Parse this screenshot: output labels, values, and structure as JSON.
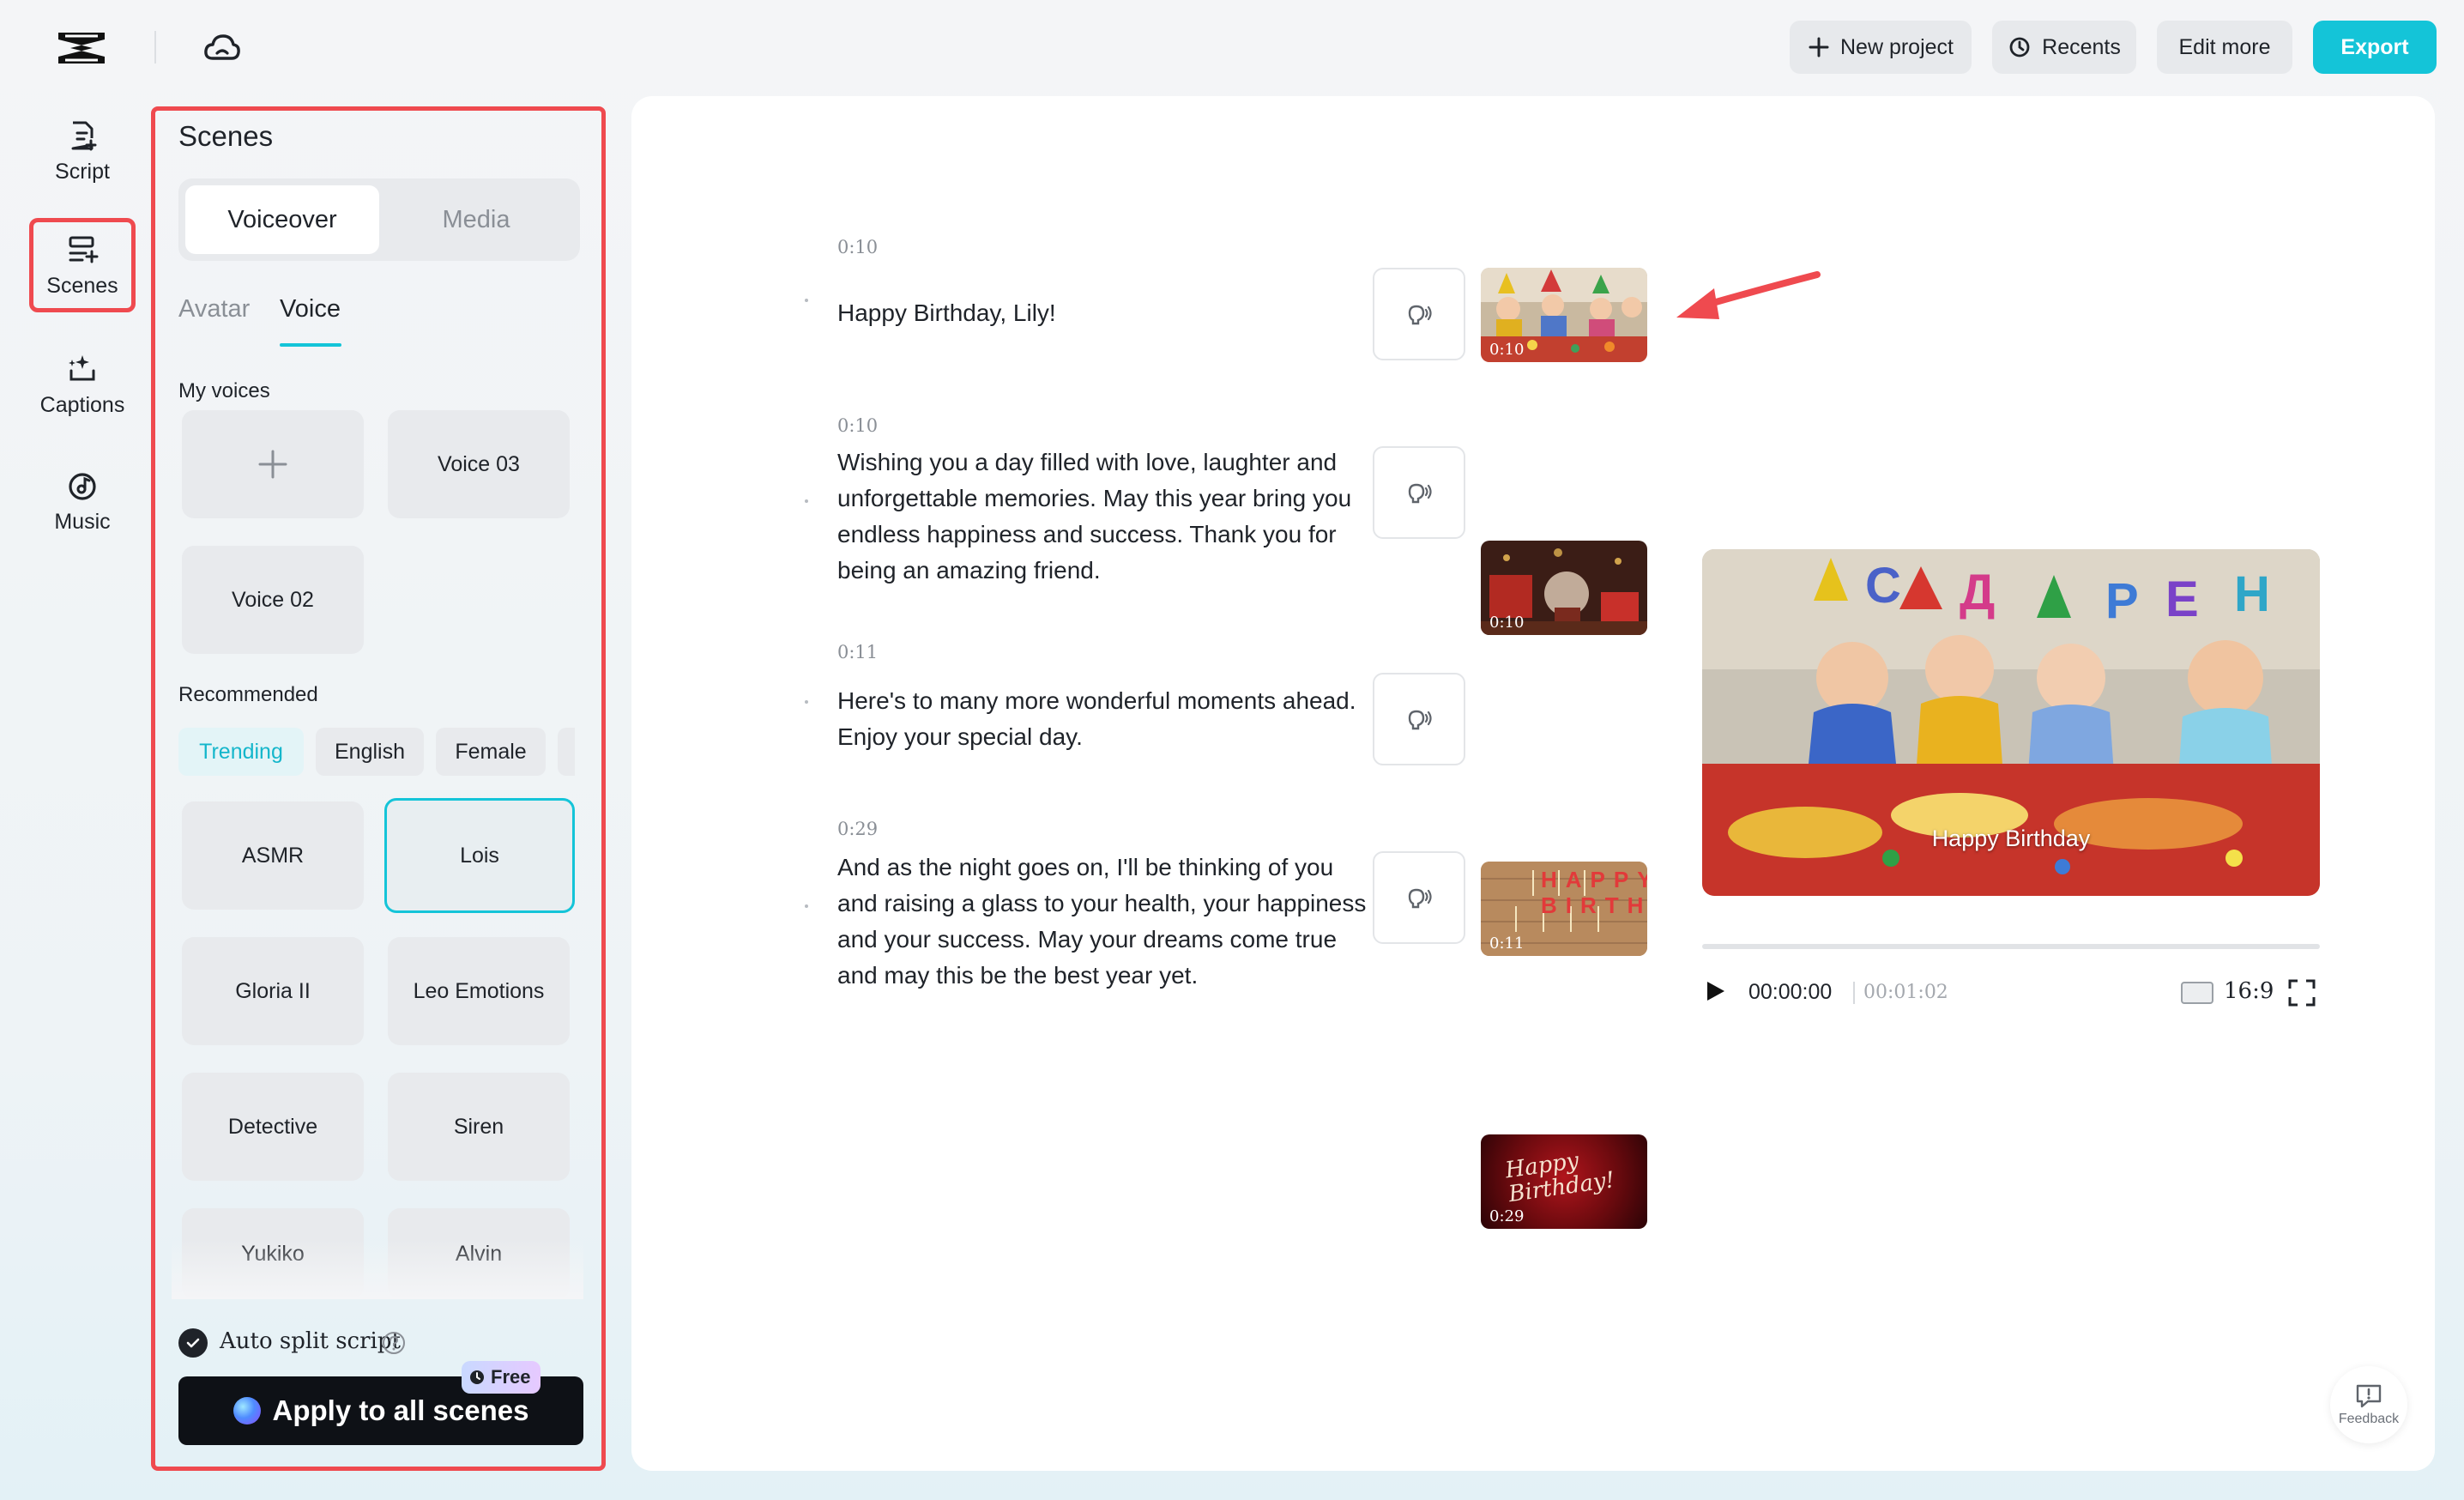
{
  "topbar": {
    "new_project": "New project",
    "recents": "Recents",
    "edit_more": "Edit more",
    "export": "Export"
  },
  "rail": {
    "items": [
      {
        "label": "Script",
        "icon": "script-icon"
      },
      {
        "label": "Scenes",
        "icon": "scenes-icon"
      },
      {
        "label": "Captions",
        "icon": "captions-icon"
      },
      {
        "label": "Music",
        "icon": "music-icon"
      }
    ]
  },
  "panel": {
    "title": "Scenes",
    "segments": [
      "Voiceover",
      "Media"
    ],
    "subtabs": [
      "Avatar",
      "Voice"
    ],
    "my_voices_label": "My voices",
    "my_voices": [
      "+",
      "Voice 03",
      "Voice 02"
    ],
    "recommended_label": "Recommended",
    "chips": [
      "Trending",
      "English",
      "Female"
    ],
    "voices": [
      "ASMR",
      "Lois",
      "Gloria II",
      "Leo Emotions",
      "Detective",
      "Siren",
      "Yukiko",
      "Alvin"
    ],
    "selected_voice": "Lois",
    "auto_split": "Auto split script",
    "apply_button": "Apply to all scenes",
    "free_badge": "Free"
  },
  "scenes": [
    {
      "time": "0:10",
      "text": "Happy Birthday, Lily!",
      "thumb_time": "0:10"
    },
    {
      "time": "0:10",
      "text": "Wishing you a day filled with love, laughter and unforgettable memories. May this year bring you endless happiness and success. Thank you for being an amazing friend.",
      "thumb_time": "0:10"
    },
    {
      "time": "0:11",
      "text": "Here's to many more wonderful moments ahead. Enjoy your special day.",
      "thumb_time": "0:11"
    },
    {
      "time": "0:29",
      "text": "And as the night goes on, I'll be thinking of you and raising a glass to your health, your happiness and your success. May your dreams come true and may this be the best year yet.",
      "thumb_time": "0:29"
    }
  ],
  "thumb_overlays": {
    "birthday_letters": "HAPPY BIRTHDAY",
    "script_text": "Happy Birthday!"
  },
  "preview": {
    "caption": "Happy Birthday",
    "current_time": "00:00:00",
    "total_time": "00:01:02",
    "ratio": "16:9",
    "progress": 0
  },
  "feedback": "Feedback",
  "colors": {
    "accent": "#14c4d8",
    "highlight_outline": "#ef4a4f"
  }
}
